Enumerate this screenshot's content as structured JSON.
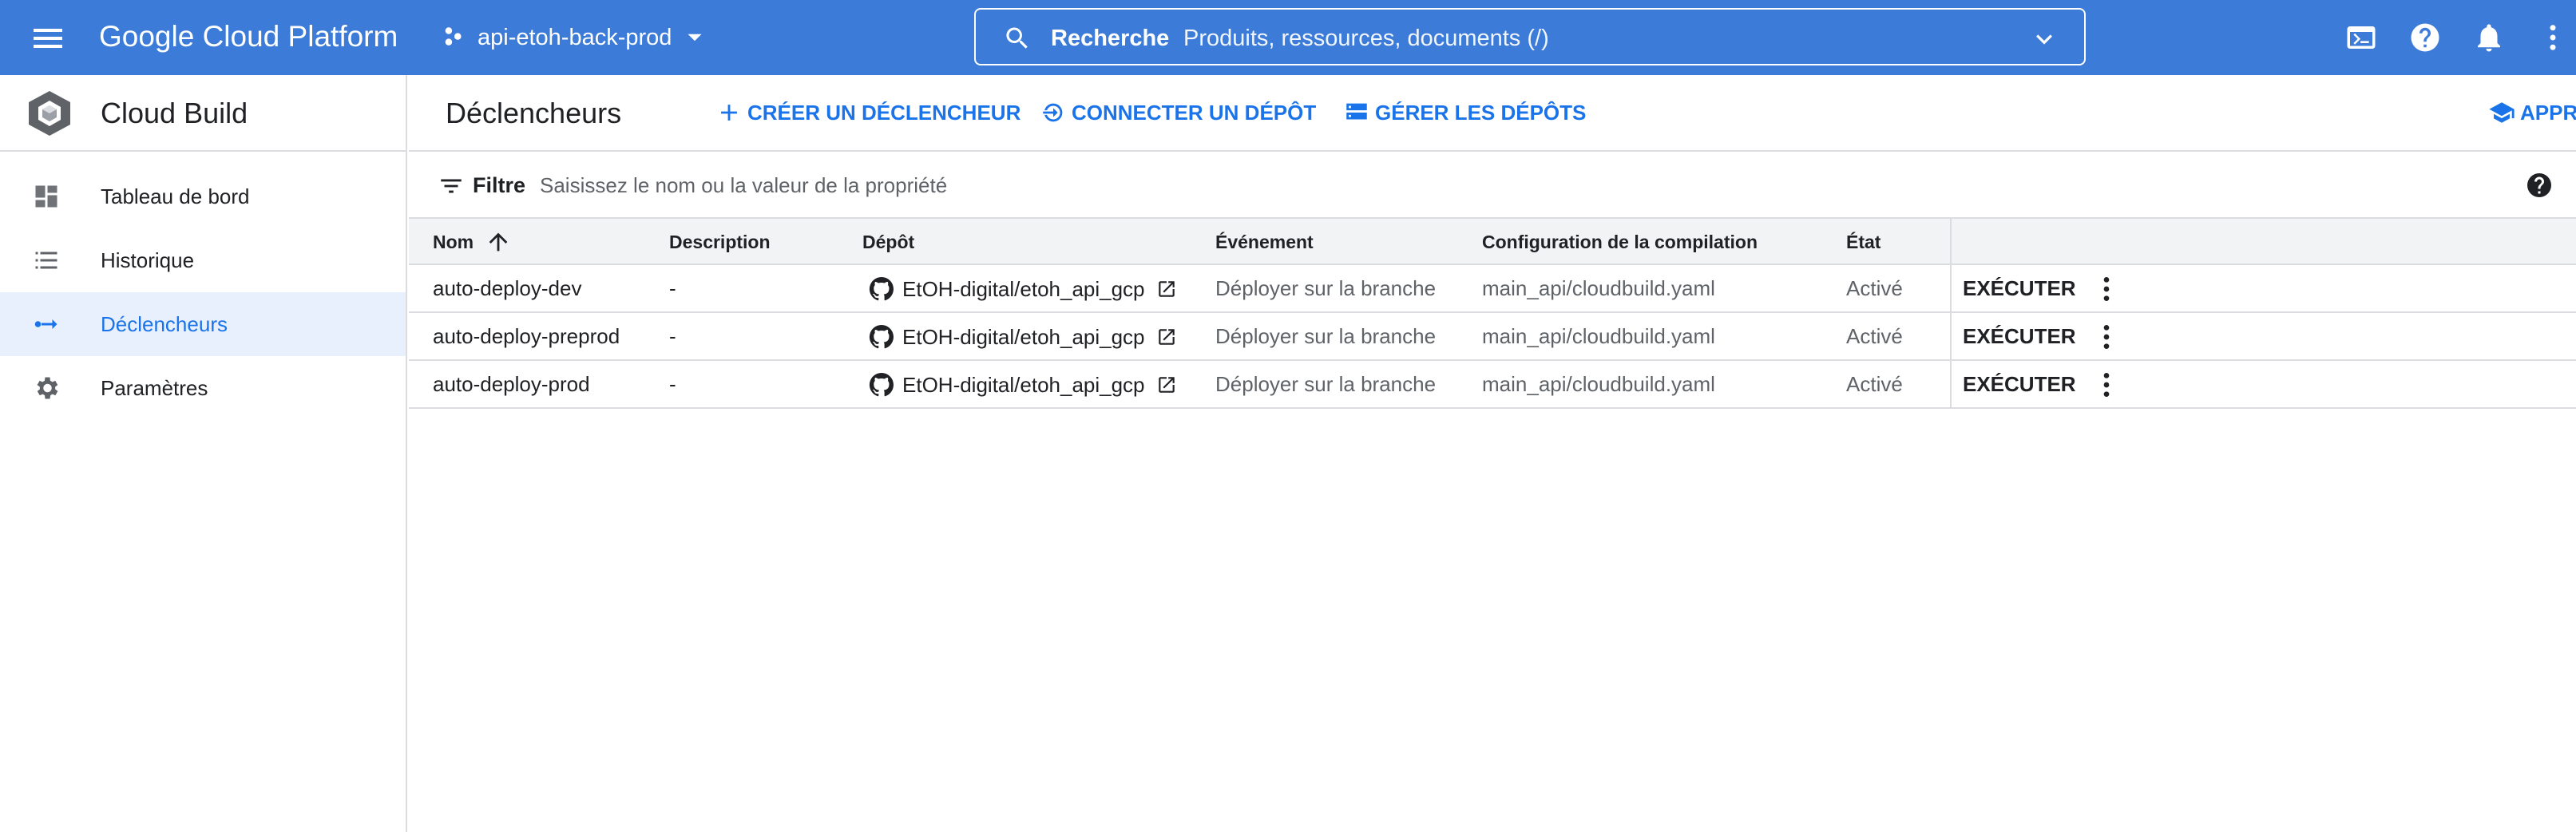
{
  "topbar": {
    "brand": "Google Cloud Platform",
    "project": "api-etoh-back-prod",
    "search_label": "Recherche",
    "search_placeholder": "Produits, ressources, documents (/)"
  },
  "sidebar": {
    "title": "Cloud Build",
    "items": [
      {
        "label": "Tableau de bord",
        "icon": "dashboard-icon"
      },
      {
        "label": "Historique",
        "icon": "list-icon"
      },
      {
        "label": "Déclencheurs",
        "icon": "trigger-arrow-icon",
        "active": true
      },
      {
        "label": "Paramètres",
        "icon": "gear-icon"
      }
    ]
  },
  "main": {
    "title": "Déclencheurs",
    "actions": {
      "create": "CRÉER UN DÉCLENCHEUR",
      "connect": "CONNECTER UN DÉPÔT",
      "manage": "GÉRER LES DÉPÔTS",
      "learn": "APPRI"
    },
    "filter": {
      "label": "Filtre",
      "placeholder": "Saisissez le nom ou la valeur de la propriété"
    },
    "table": {
      "columns": [
        "Nom",
        "Description",
        "Dépôt",
        "Événement",
        "Configuration de la compilation",
        "État"
      ],
      "run_label": "EXÉCUTER",
      "rows": [
        {
          "name": "auto-deploy-dev",
          "description": "-",
          "repo": "EtOH-digital/etoh_api_gcp",
          "event": "Déployer sur la branche",
          "config": "main_api/cloudbuild.yaml",
          "state": "Activé"
        },
        {
          "name": "auto-deploy-preprod",
          "description": "-",
          "repo": "EtOH-digital/etoh_api_gcp",
          "event": "Déployer sur la branche",
          "config": "main_api/cloudbuild.yaml",
          "state": "Activé"
        },
        {
          "name": "auto-deploy-prod",
          "description": "-",
          "repo": "EtOH-digital/etoh_api_gcp",
          "event": "Déployer sur la branche",
          "config": "main_api/cloudbuild.yaml",
          "state": "Activé"
        }
      ]
    }
  },
  "colors": {
    "topbar": "#3c7bd8",
    "accent": "#1a73e8",
    "active_bg": "#e8f0fe",
    "header_bg": "#f1f3f4"
  }
}
